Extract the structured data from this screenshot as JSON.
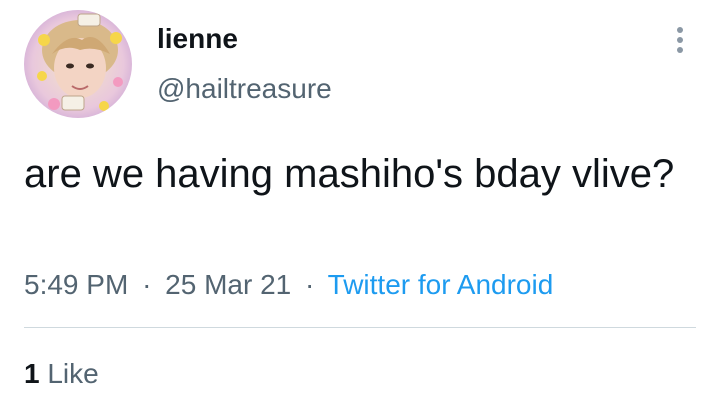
{
  "tweet": {
    "author": {
      "display_name": "lienne",
      "handle": "@hailtreasure"
    },
    "text": "are we having mashiho's bday vlive?",
    "time": "5:49 PM",
    "separator": "·",
    "date": "25 Mar 21",
    "source": "Twitter for Android",
    "likes": {
      "count": "1",
      "label": "Like"
    }
  },
  "icons": {
    "more": "vertical-ellipsis-icon",
    "avatar": "avatar-image"
  },
  "colors": {
    "text_primary": "#0f1419",
    "text_secondary": "#536471",
    "link": "#1d9bf0",
    "divider": "#cfd9de"
  }
}
